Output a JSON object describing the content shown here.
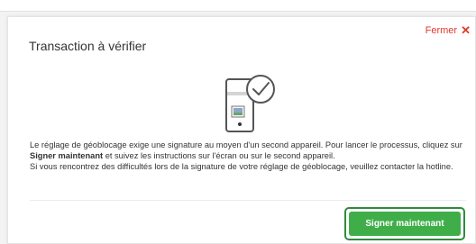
{
  "modal": {
    "title": "Transaction à vérifier",
    "close_label": "Fermer",
    "close_icon": "✕",
    "illustration_icon": "phone-check-icon",
    "message": {
      "line1_part1": "Le réglage de géoblocage exige une signature au moyen d'un second appareil. Pour lancer le processus, cliquez sur ",
      "line1_bold": "Signer maintenant",
      "line1_part2": " et suivez les instructions sur l'écran ou sur le second appareil.",
      "line2": "Si vous rencontrez des difficultés lors de la signature de votre réglage de géoblocage, veuillez contacter la hotline."
    },
    "primary_button_label": "Signer maintenant",
    "colors": {
      "accent_red": "#e0392b",
      "button_green": "#3fae49",
      "button_border_green": "#2e8b3d"
    }
  }
}
